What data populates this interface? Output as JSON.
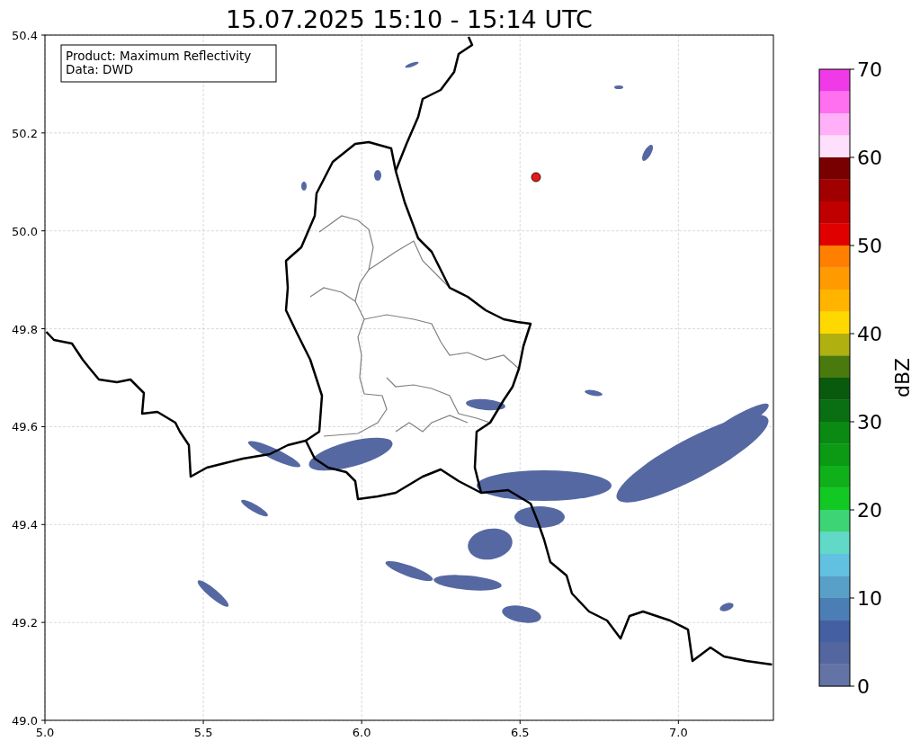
{
  "title": "15.07.2025 15:10 - 15:14 UTC",
  "map": {
    "x_tick_labels": [
      "5.0",
      "5.5",
      "6.0",
      "6.5",
      "7.0"
    ],
    "y_tick_labels": [
      "50.4",
      "50.2",
      "50.0",
      "49.8",
      "49.6",
      "49.4",
      "49.2",
      "49.0"
    ],
    "info": [
      "Product: Maximum Reflectivity",
      "Data: DWD"
    ]
  },
  "colorbar": {
    "label": "dBZ",
    "ticks": [
      "70",
      "60",
      "50",
      "40",
      "30",
      "20",
      "10",
      "0"
    ],
    "bins": [
      {
        "color": "#f03ae8"
      },
      {
        "color": "#ff70f0"
      },
      {
        "color": "#ffb0f8"
      },
      {
        "color": "#ffe0fc"
      },
      {
        "color": "#780000"
      },
      {
        "color": "#a00000"
      },
      {
        "color": "#c00000"
      },
      {
        "color": "#e00000"
      },
      {
        "color": "#ff8000"
      },
      {
        "color": "#ff9a00"
      },
      {
        "color": "#ffb400"
      },
      {
        "color": "#ffd800"
      },
      {
        "color": "#b0b010"
      },
      {
        "color": "#4a7a0e"
      },
      {
        "color": "#0a5a0e"
      },
      {
        "color": "#0a6e12"
      },
      {
        "color": "#0a8a12"
      },
      {
        "color": "#0c9a14"
      },
      {
        "color": "#10b01a"
      },
      {
        "color": "#12c822"
      },
      {
        "color": "#3cd474"
      },
      {
        "color": "#62d8c8"
      },
      {
        "color": "#62c0e0"
      },
      {
        "color": "#58a0c8"
      },
      {
        "color": "#4a7eb4"
      },
      {
        "color": "#4460a2"
      },
      {
        "color": "#5466a0"
      },
      {
        "color": "#6373a6"
      }
    ]
  }
}
